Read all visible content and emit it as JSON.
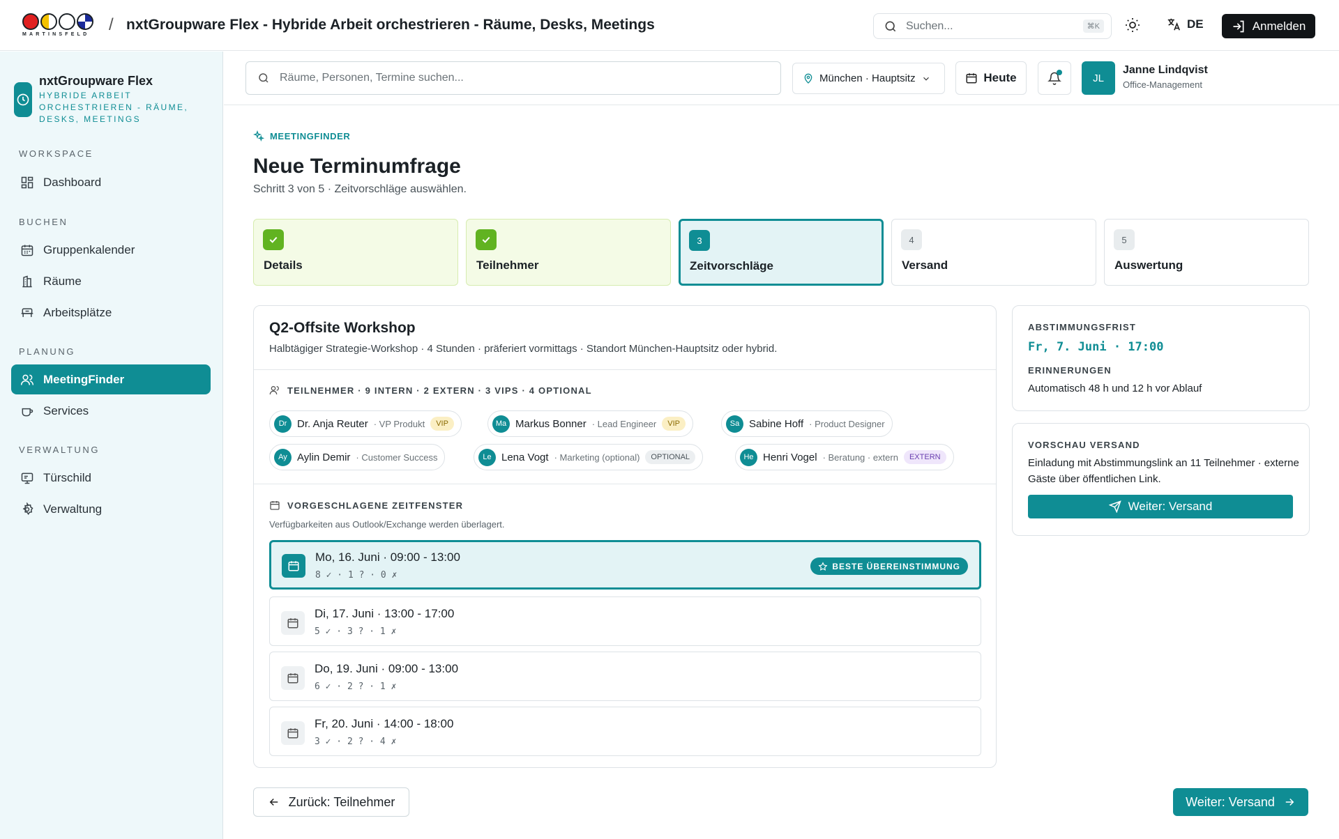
{
  "header": {
    "logo_text": "MARTINSFELD",
    "separator": "/",
    "title": "nxtGroupware Flex - Hybride Arbeit orchestrieren - Räume, Desks, Meetings",
    "search_placeholder": "Suchen...",
    "search_shortcut": "⌘K",
    "language": "DE",
    "login_label": "Anmelden"
  },
  "sidebar": {
    "brand_name": "nxtGroupware Flex",
    "brand_sub": "Hybride Arbeit orchestrieren - Räume, Desks, Meetings",
    "sections": [
      {
        "label": "WORKSPACE",
        "items": [
          {
            "label": "Dashboard",
            "icon": "dashboard-icon"
          }
        ]
      },
      {
        "label": "BUCHEN",
        "items": [
          {
            "label": "Gruppenkalender",
            "icon": "calendar-icon"
          },
          {
            "label": "Räume",
            "icon": "building-icon"
          },
          {
            "label": "Arbeitsplätze",
            "icon": "desk-icon"
          }
        ]
      },
      {
        "label": "PLANUNG",
        "items": [
          {
            "label": "MeetingFinder",
            "icon": "users-icon",
            "active": true
          },
          {
            "label": "Services",
            "icon": "coffee-icon"
          }
        ]
      },
      {
        "label": "VERWALTUNG",
        "items": [
          {
            "label": "Türschild",
            "icon": "display-icon"
          },
          {
            "label": "Verwaltung",
            "icon": "gear-icon"
          }
        ]
      }
    ]
  },
  "toolbar": {
    "search_placeholder": "Räume, Personen, Termine suchen...",
    "location": "München · Hauptsitz",
    "today_label": "Heute",
    "user_initials": "JL",
    "user_name": "Janne Lindqvist",
    "user_role": "Office-Management"
  },
  "page": {
    "eyebrow": "MEETINGFINDER",
    "title": "Neue Terminumfrage",
    "subtitle": "Schritt 3 von 5 · Zeitvorschläge auswählen."
  },
  "steps": [
    {
      "num": "1",
      "label": "Details",
      "state": "done"
    },
    {
      "num": "2",
      "label": "Teilnehmer",
      "state": "done"
    },
    {
      "num": "3",
      "label": "Zeitvorschläge",
      "state": "active"
    },
    {
      "num": "4",
      "label": "Versand",
      "state": "todo"
    },
    {
      "num": "5",
      "label": "Auswertung",
      "state": "todo"
    }
  ],
  "meeting": {
    "title": "Q2-Offsite Workshop",
    "description": "Halbtägiger Strategie-Workshop · 4 Stunden · präferiert vormittags · Standort München-Hauptsitz oder hybrid.",
    "participants_caption": "TEILNEHMER · 9 INTERN · 2 EXTERN · 3 VIPS · 4 OPTIONAL",
    "participants": [
      {
        "initials": "Dr",
        "name": "Dr. Anja Reuter",
        "role": "VP Produkt",
        "tag": "VIP",
        "tag_type": "vip"
      },
      {
        "initials": "Ma",
        "name": "Markus Bonner",
        "role": "Lead Engineer",
        "tag": "VIP",
        "tag_type": "vip"
      },
      {
        "initials": "Sa",
        "name": "Sabine Hoff",
        "role": "Product Designer",
        "tag": "",
        "tag_type": ""
      },
      {
        "initials": "Ay",
        "name": "Aylin Demir",
        "role": "Customer Success",
        "tag": "",
        "tag_type": ""
      },
      {
        "initials": "Le",
        "name": "Lena Vogt",
        "role": "Marketing (optional)",
        "tag": "OPTIONAL",
        "tag_type": "opt"
      },
      {
        "initials": "He",
        "name": "Henri Vogel",
        "role": "Beratung · extern",
        "tag": "EXTERN",
        "tag_type": "ext"
      }
    ],
    "slots_caption": "VORGESCHLAGENE ZEITFENSTER",
    "slots_note": "Verfügbarkeiten aus Outlook/Exchange werden überlagert.",
    "best_badge": "BESTE ÜBEREINSTIMMUNG",
    "slots": [
      {
        "when": "Mo, 16. Juni · 09:00 - 13:00",
        "votes": "8 ✓ · 1 ? · 0 ✗",
        "best": true
      },
      {
        "when": "Di, 17. Juni · 13:00 - 17:00",
        "votes": "5 ✓ · 3 ? · 1 ✗",
        "best": false
      },
      {
        "when": "Do, 19. Juni · 09:00 - 13:00",
        "votes": "6 ✓ · 2 ? · 1 ✗",
        "best": false
      },
      {
        "when": "Fr, 20. Juni · 14:00 - 18:00",
        "votes": "3 ✓ · 2 ? · 4 ✗",
        "best": false
      }
    ]
  },
  "deadline_panel": {
    "label": "ABSTIMMUNGSFRIST",
    "value": "Fr, 7. Juni · 17:00",
    "reminder_label": "ERINNERUNGEN",
    "reminder_text": "Automatisch 48 h und 12 h vor Ablauf"
  },
  "preview_panel": {
    "label": "VORSCHAU VERSAND",
    "text": "Einladung mit Abstimmungslink an 11 Teilnehmer · externe Gäste über öffentlichen Link.",
    "button": "Weiter: Versand"
  },
  "footer": {
    "back_label": "Zurück: Teilnehmer",
    "next_label": "Weiter: Versand"
  },
  "colors": {
    "accent": "#0f8d94",
    "done": "#61b321",
    "dark": "#111417"
  }
}
